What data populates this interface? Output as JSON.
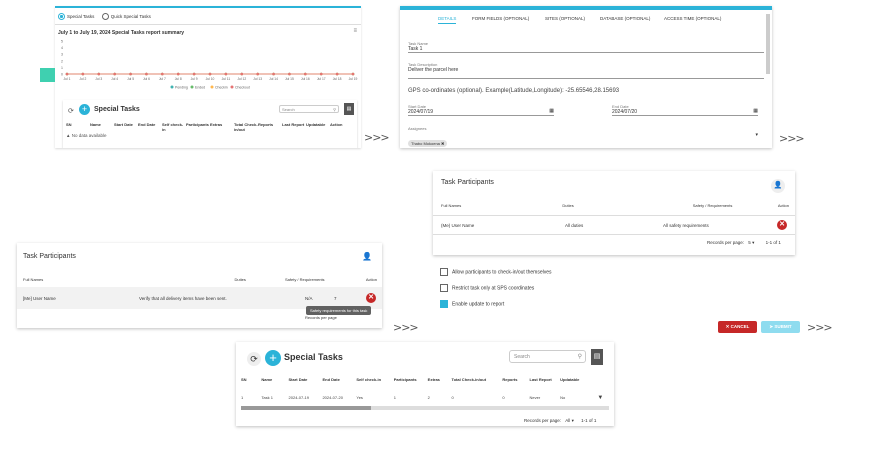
{
  "panel1": {
    "radio_special": "Special Tasks",
    "radio_quick": "Quick Special Tasks",
    "chart_title": "July 1 to July 19, 2024 Special Tasks report summary",
    "menu_icon": "menu-icon",
    "table_title": "Special Tasks",
    "search_placeholder": "Search",
    "columns": [
      "SN",
      "Name",
      "Start Date",
      "End Date",
      "Self check-in",
      "Participants",
      "Extras",
      "Total Check-in/out",
      "Reports",
      "Last Report",
      "Updatable",
      "Action"
    ],
    "empty_text": "No data available"
  },
  "chart_data": {
    "type": "line",
    "title": "July 1 to July 19, 2024 Special Tasks report summary",
    "categories": [
      "Jul 1",
      "Jul 2",
      "Jul 3",
      "Jul 4",
      "Jul 5",
      "Jul 6",
      "Jul 7",
      "Jul 8",
      "Jul 9",
      "Jul 10",
      "Jul 11",
      "Jul 12",
      "Jul 13",
      "Jul 14",
      "Jul 15",
      "Jul 16",
      "Jul 17",
      "Jul 18",
      "Jul 19"
    ],
    "series": [
      {
        "name": "Pending",
        "values": [
          0,
          0,
          0,
          0,
          0,
          0,
          0,
          0,
          0,
          0,
          0,
          0,
          0,
          0,
          0,
          0,
          0,
          0,
          0
        ],
        "color": "#3fb3b0"
      },
      {
        "name": "Ended",
        "values": [
          0,
          0,
          0,
          0,
          0,
          0,
          0,
          0,
          0,
          0,
          0,
          0,
          0,
          0,
          0,
          0,
          0,
          0,
          0
        ],
        "color": "#66bb6a"
      },
      {
        "name": "Checkin",
        "values": [
          0,
          0,
          0,
          0,
          0,
          0,
          0,
          0,
          0,
          0,
          0,
          0,
          0,
          0,
          0,
          0,
          0,
          0,
          0
        ],
        "color": "#ffb74d"
      },
      {
        "name": "Checkout",
        "values": [
          0,
          0,
          0,
          0,
          0,
          0,
          0,
          0,
          0,
          0,
          0,
          0,
          0,
          0,
          0,
          0,
          0,
          0,
          0
        ],
        "color": "#e57373"
      }
    ],
    "yticks": [
      "5",
      "4",
      "3",
      "2",
      "1",
      "0"
    ],
    "ylim": [
      0,
      5
    ]
  },
  "panel2": {
    "tabs": [
      "DETAILS",
      "FORM FIELDS (OPTIONAL)",
      "SITES (OPTIONAL)",
      "DATABASE (OPTIONAL)",
      "ACCESS TIME (OPTIONAL)"
    ],
    "task_name_label": "Task Name",
    "task_name_value": "Task 1",
    "desc_label": "Task Description",
    "desc_value": "Deliver the parcel here",
    "gps_text": "GPS co-ordinates (optional). Example(Latitude,Longitude): -25.65546,28.15693",
    "start_label": "Start Date",
    "start_value": "2024/07/19",
    "end_label": "End Date",
    "end_value": "2024/07/20",
    "assign_label": "Assignees",
    "assign_chip": "Thabo Mokoena"
  },
  "panel3": {
    "title": "Task Participants",
    "columns": [
      "Full Names",
      "Duties",
      "Safety / Requirements",
      "Action"
    ],
    "row": [
      "[Me] User Name",
      "Verify that all delivery items have been sent.",
      "N/A"
    ],
    "row_count": "7",
    "tooltip": "Safety requirements for this task",
    "footer": "Records per page"
  },
  "panel4": {
    "title": "Task Participants",
    "columns": [
      "Full Names",
      "Duties",
      "Safety / Requirements",
      "Action"
    ],
    "row": [
      "(Me) User Name",
      "All duties",
      "All safety requirements"
    ],
    "records_label": "Records per page:",
    "records_value": "5",
    "range": "1-1 of 1",
    "checks": [
      {
        "label": "Allow participants to check-in/out themselves",
        "checked": false
      },
      {
        "label": "Restrict task only at SPS coordinates",
        "checked": false
      },
      {
        "label": "Enable update to report",
        "checked": true
      }
    ],
    "cancel": "CANCEL",
    "submit": "SUBMIT"
  },
  "panel5": {
    "title": "Special Tasks",
    "search_placeholder": "Search",
    "columns": [
      "SN",
      "Name",
      "Start Date",
      "End Date",
      "Self check-in",
      "Participants",
      "Extras",
      "Total Check-in/out",
      "Reports",
      "Last Report",
      "Updatable"
    ],
    "row": [
      "1",
      "Task 1",
      "2024-07-19",
      "2024-07-20",
      "Yes",
      "1",
      "2",
      "0",
      "0",
      "Never",
      "No"
    ],
    "records_label": "Records per page:",
    "records_value": "All",
    "range": "1-1 of 1"
  },
  "arrows": [
    ">>>",
    ">>>",
    ">>>",
    ">>>"
  ]
}
